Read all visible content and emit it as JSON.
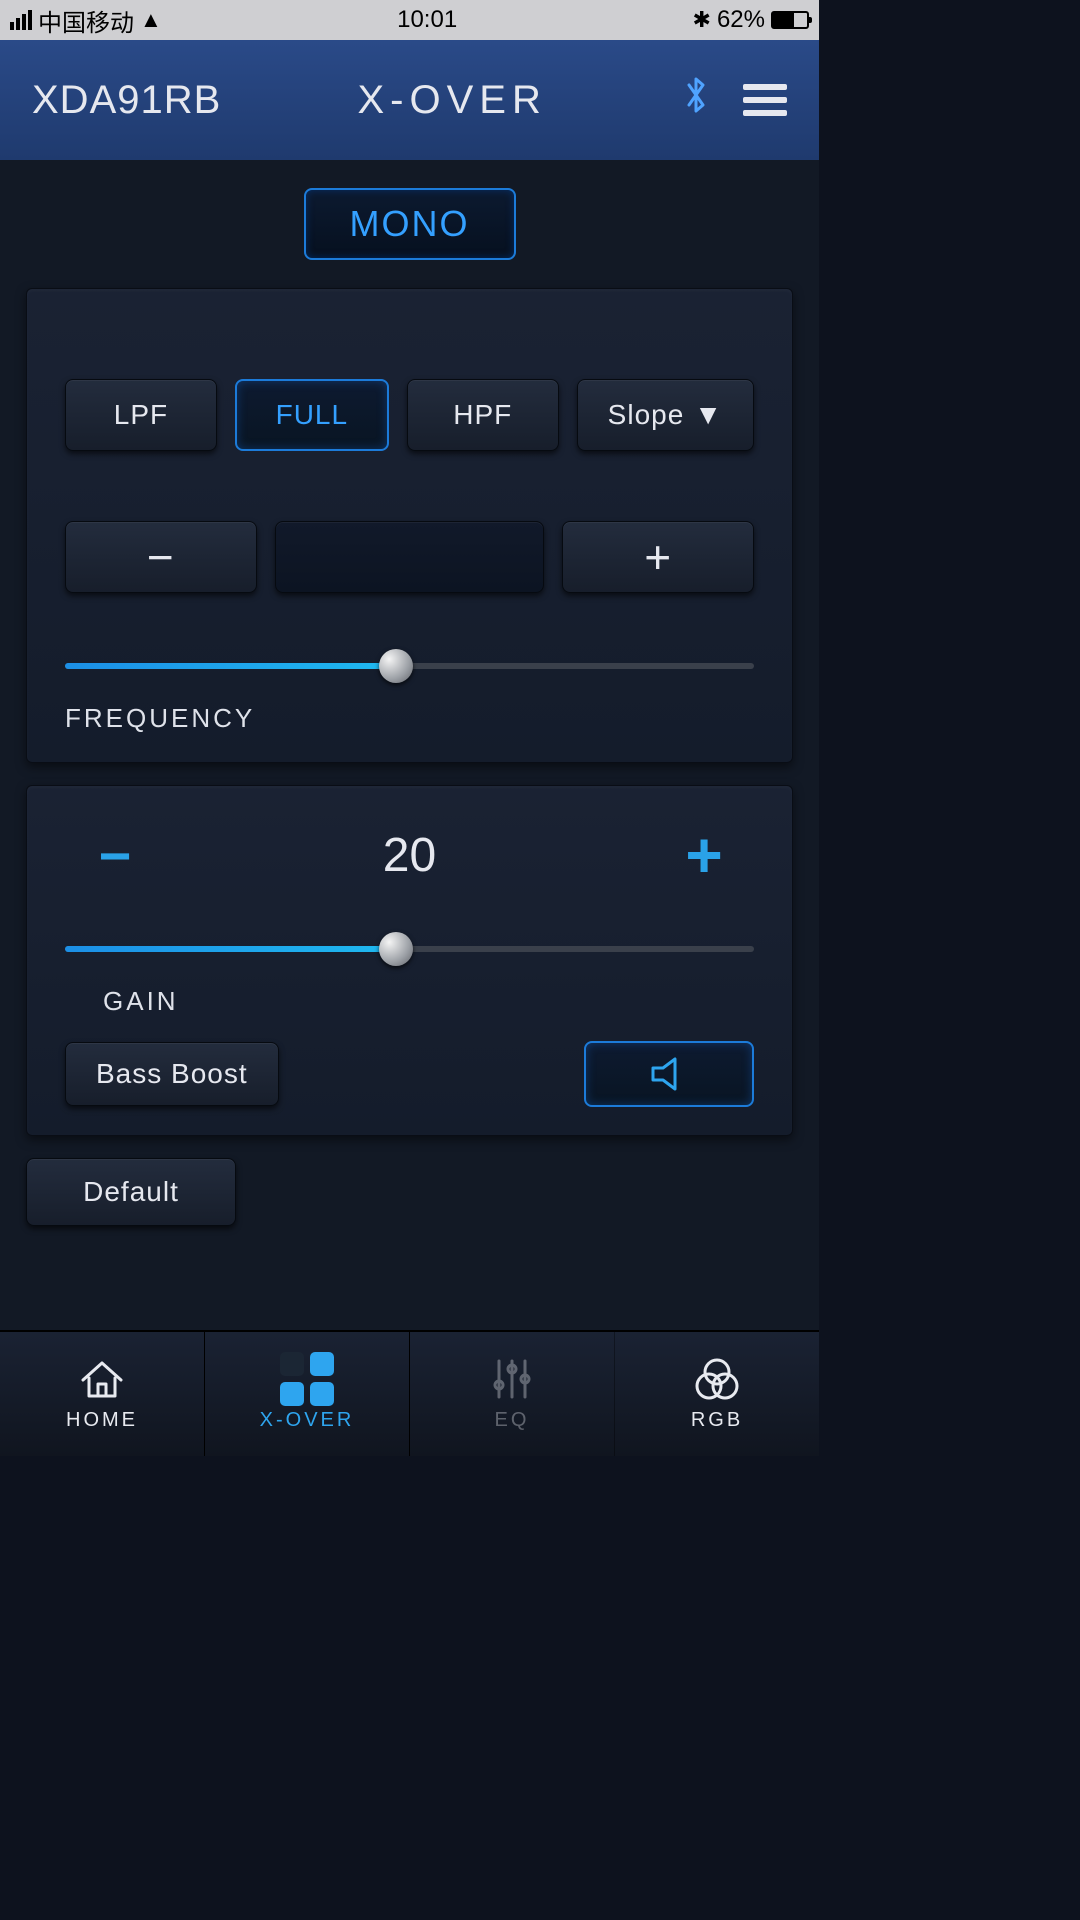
{
  "status": {
    "carrier": "中国移动",
    "time": "10:01",
    "battery_pct": "62%"
  },
  "header": {
    "device": "XDA91RB",
    "title": "X-OVER"
  },
  "mono_label": "MONO",
  "filter": {
    "lpf": "LPF",
    "full": "FULL",
    "hpf": "HPF",
    "slope": "Slope",
    "freq_display": "",
    "freq_section": "FREQUENCY",
    "slider_pct": 48
  },
  "gain": {
    "value": "20",
    "label": "GAIN",
    "bass_boost": "Bass Boost",
    "slider_pct": 48
  },
  "default_label": "Default",
  "nav": {
    "home": "HOME",
    "xover": "X-OVER",
    "eq": "EQ",
    "rgb": "RGB"
  }
}
